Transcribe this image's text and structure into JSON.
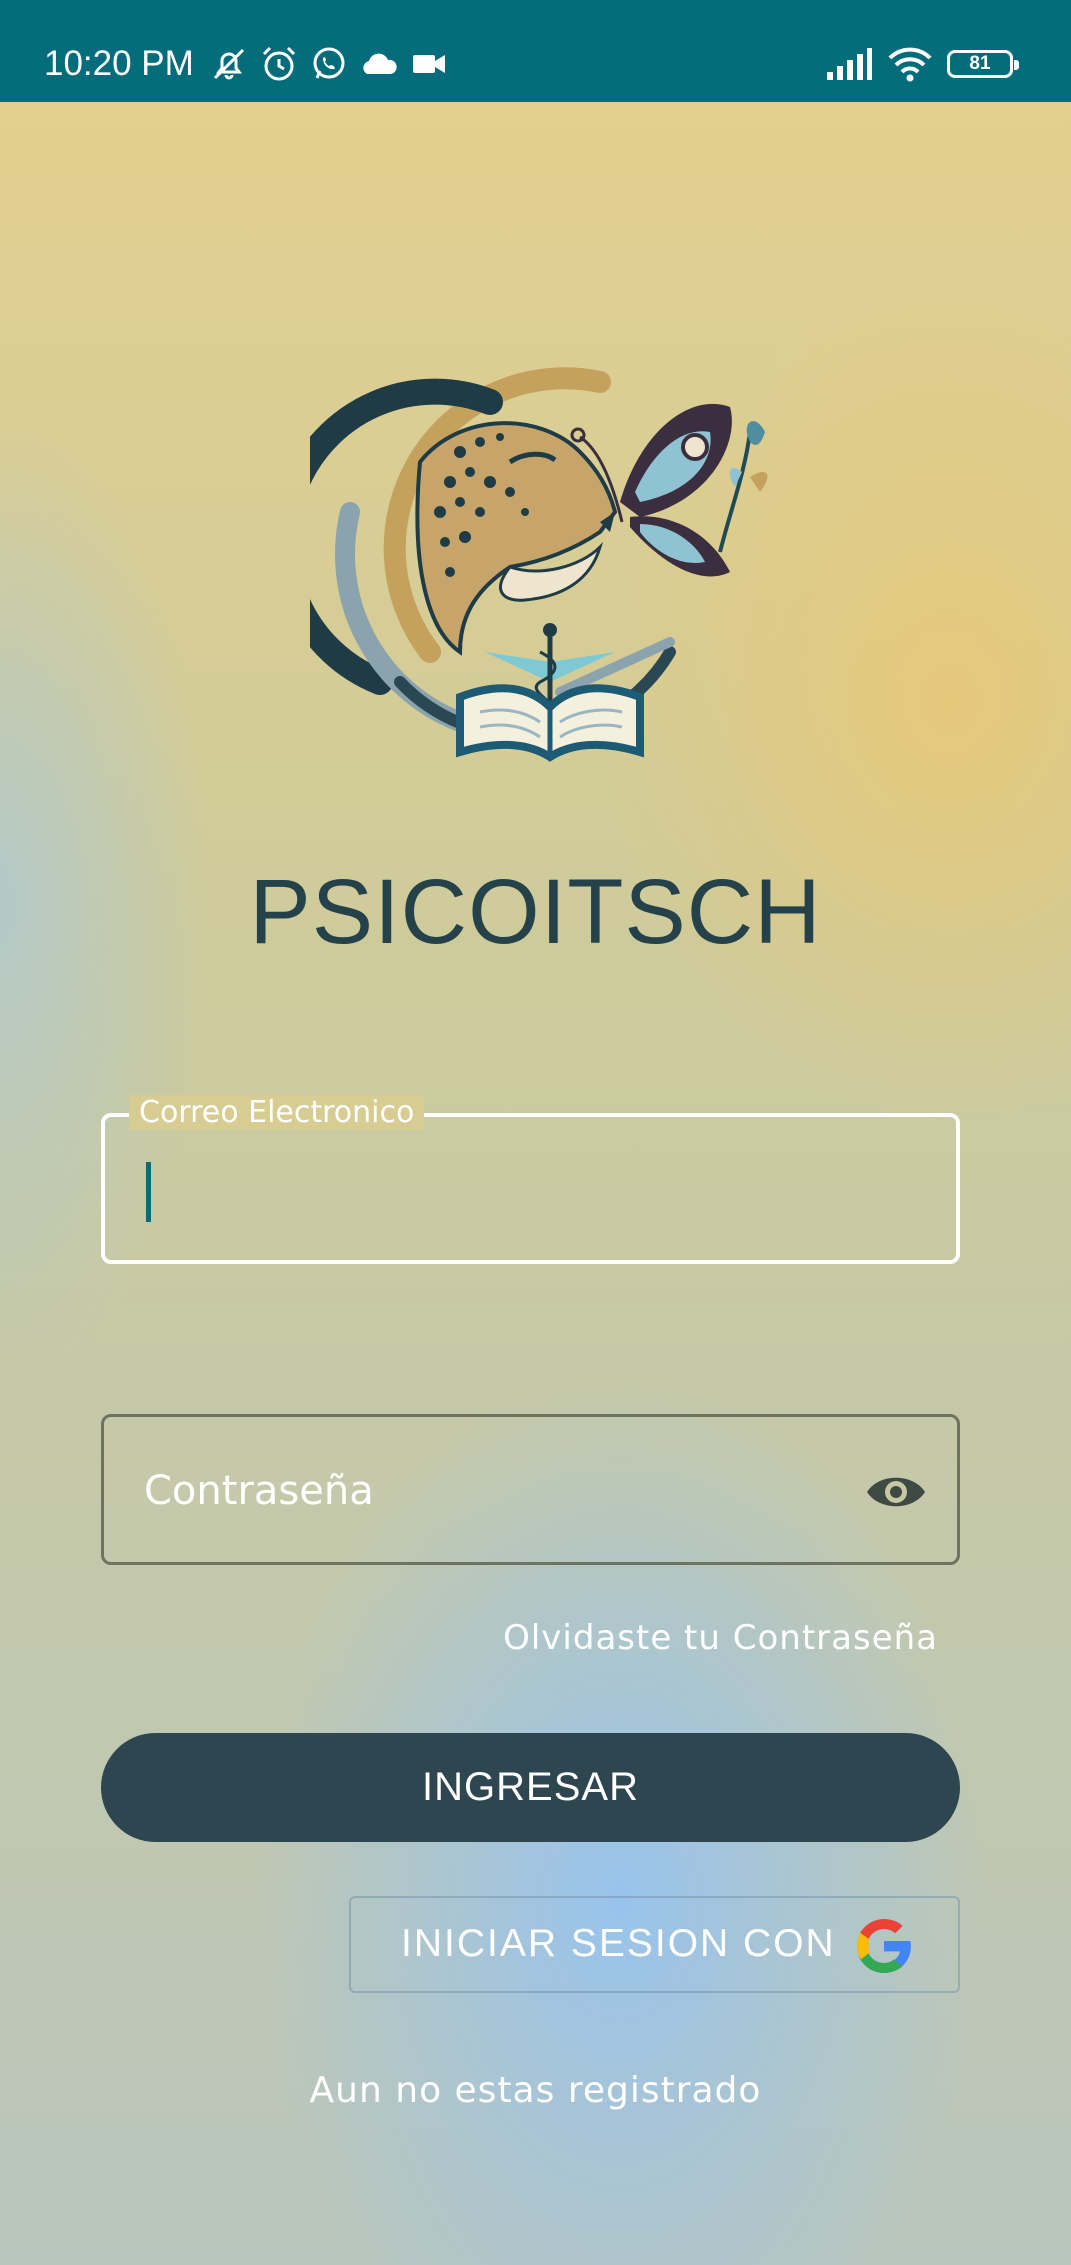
{
  "status_bar": {
    "time": "10:20 PM",
    "battery": "81",
    "icons_left": [
      "mute-icon",
      "alarm-icon",
      "whatsapp-icon",
      "cloud-icon",
      "video-icon"
    ],
    "icons_right": [
      "signal-icon",
      "wifi-icon",
      "battery-icon"
    ]
  },
  "app": {
    "title": "PSICOITSCH",
    "logo": "psicoitsch-logo"
  },
  "form": {
    "email_label": "Correo Electronico",
    "email_value": "",
    "password_placeholder": "Contraseña",
    "password_value": "",
    "forgot_link": "Olvidaste tu Contraseña",
    "login_button": "INGRESAR",
    "google_button": "INICIAR SESION CON",
    "register_link": "Aun no estas registrado"
  },
  "colors": {
    "status_bar": "#046c7a",
    "title": "#25414a",
    "primary_button": "#2e4650",
    "caret": "#0b6c78"
  }
}
